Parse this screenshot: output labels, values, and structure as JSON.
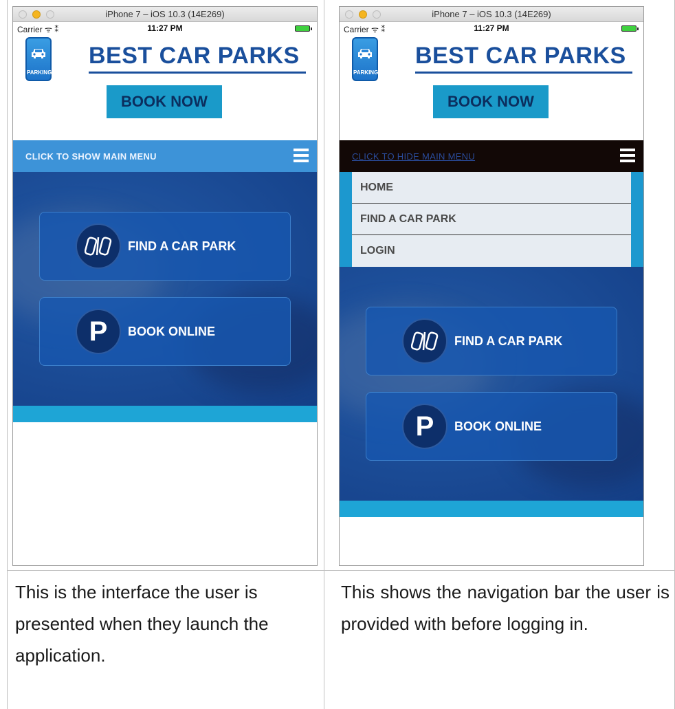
{
  "left_screen": {
    "window_title": "iPhone 7 – iOS 10.3 (14E269)",
    "carrier": "Carrier ᯤ ⁑",
    "time": "11:27 PM",
    "logo_text": "PARKING",
    "brand": "BEST CAR PARKS",
    "book_now": "BOOK NOW",
    "menu_toggle": "CLICK TO SHOW MAIN MENU",
    "tiles": [
      {
        "label": "FIND A CAR PARK",
        "icon": "car-park-icon"
      },
      {
        "label": "BOOK ONLINE",
        "icon": "parking-p-icon",
        "glyph": "P"
      }
    ]
  },
  "right_screen": {
    "window_title": "iPhone 7 – iOS 10.3 (14E269)",
    "carrier": "Carrier ᯤ ⁑",
    "time": "11:27 PM",
    "logo_text": "PARKING",
    "brand": "BEST CAR PARKS",
    "book_now": "BOOK NOW",
    "menu_toggle": "CLICK TO HIDE MAIN MENU",
    "nav_items": [
      "HOME",
      "FIND A CAR PARK",
      "LOGIN"
    ],
    "tiles": [
      {
        "label": "FIND A CAR PARK",
        "icon": "car-park-icon"
      },
      {
        "label": "BOOK ONLINE",
        "icon": "parking-p-icon",
        "glyph": "P"
      }
    ]
  },
  "captions": {
    "left": "This is the interface the user is presented when they launch the application.",
    "right": "This shows the navigation bar the user is provided with before logging in."
  },
  "colors": {
    "brand_blue": "#1a4f9c",
    "book_button": "#1a9ac9",
    "menu_show_bar": "#3d93d8",
    "menu_hide_bar": "#120806",
    "tile_blue": "#1757af",
    "footer_strip": "#1ea5d6"
  }
}
